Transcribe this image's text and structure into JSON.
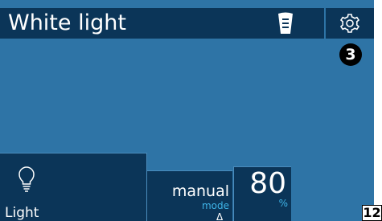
{
  "header": {
    "title": "White light",
    "remote_icon": "remote-control-icon",
    "settings_icon": "gear-icon"
  },
  "callout": {
    "number": "3"
  },
  "tiles": {
    "light": {
      "label": "Light",
      "icon": "light-bulb-icon"
    },
    "mode": {
      "value": "manual",
      "caption": "mode",
      "arrow": "Δ"
    },
    "intensity": {
      "value": "80",
      "unit": "%"
    }
  },
  "figure": {
    "page_number": "12"
  },
  "colors": {
    "background": "#2e74a6",
    "panel": "#0b3558",
    "text": "#ffffff",
    "accent": "#3fb4e8"
  }
}
